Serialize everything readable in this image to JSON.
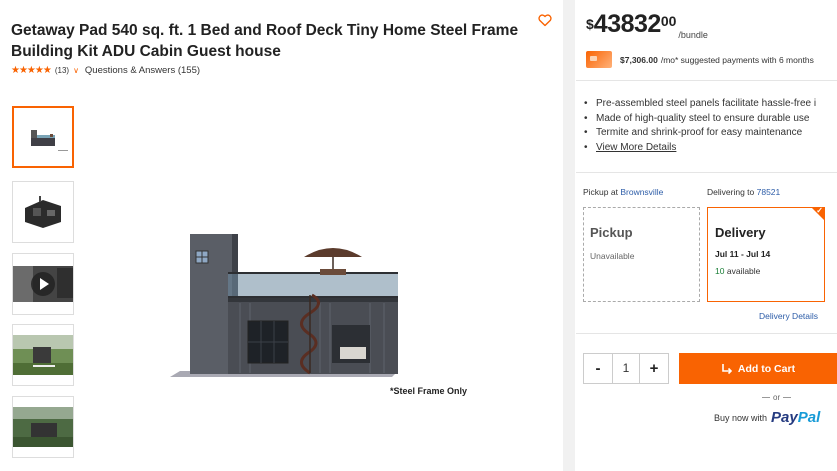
{
  "product": {
    "title": "Getaway Pad 540 sq. ft. 1 Bed and Roof Deck Tiny Home Steel Frame Building Kit ADU Cabin Guest house",
    "rating_stars": "★★★★★",
    "rating_count": "(13)",
    "qa_label": "Questions & Answers (155)",
    "image_note": "*Steel Frame Only"
  },
  "price": {
    "currency": "$",
    "whole": "43832",
    "cents": "00",
    "unit": "/bundle"
  },
  "finance": {
    "amount": "$7,306.00",
    "text": "/mo* suggested payments with 6 months"
  },
  "bullets": [
    "Pre-assembled steel panels facilitate hassle-free i",
    "Made of high-quality steel to ensure durable use",
    "Termite and shrink-proof for easy maintenance",
    "View More Details"
  ],
  "fulfillment": {
    "pickup_prefix": "Pickup at",
    "pickup_store": "Brownsville",
    "delivery_prefix": "Delivering to",
    "delivery_zip": "78521",
    "pickup_title": "Pickup",
    "pickup_status": "Unavailable",
    "delivery_title": "Delivery",
    "delivery_dates": "Jul 11 - Jul 14",
    "available_count": "10",
    "available_label": "available",
    "details_link": "Delivery Details"
  },
  "cart": {
    "minus": "-",
    "quantity": "1",
    "plus": "+",
    "add_label": "Add to Cart",
    "or_label": "or",
    "buy_now": "Buy now with",
    "paypal_1": "Pay",
    "paypal_2": "Pal"
  },
  "colors": {
    "accent": "#f96302",
    "link": "#2d5da8"
  }
}
